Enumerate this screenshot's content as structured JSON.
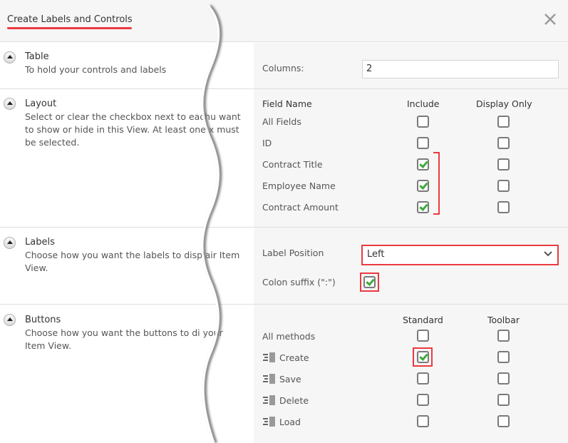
{
  "dialog": {
    "title": "Create Labels and Controls",
    "close_icon": "close-icon"
  },
  "sections": {
    "table": {
      "title": "Table",
      "description": "To hold your controls and labels",
      "columns_label": "Columns:",
      "columns_value": "2"
    },
    "layout": {
      "title": "Layout",
      "description": "Select or clear the checkbox next to eachu want to show or hide in this View. At least one x must be selected.",
      "headers": {
        "field_name": "Field Name",
        "include": "Include",
        "display_only": "Display Only"
      },
      "rows": [
        {
          "name": "All Fields",
          "include": false,
          "display_only": false
        },
        {
          "name": "ID",
          "include": false,
          "display_only": false
        },
        {
          "name": "Contract Title",
          "include": true,
          "display_only": false
        },
        {
          "name": "Employee Name",
          "include": true,
          "display_only": false
        },
        {
          "name": "Contract Amount",
          "include": true,
          "display_only": false
        }
      ]
    },
    "labels": {
      "title": "Labels",
      "description": "Choose how you want the labels to displair Item View.",
      "label_position_label": "Label Position",
      "label_position_value": "Left",
      "colon_suffix_label": "Colon suffix (\":\")",
      "colon_suffix_checked": true
    },
    "buttons": {
      "title": "Buttons",
      "description": "Choose how you want the buttons to di your Item View.",
      "headers": {
        "standard": "Standard",
        "toolbar": "Toolbar"
      },
      "rows": [
        {
          "name": "All methods",
          "icon": null,
          "standard": false,
          "toolbar": false
        },
        {
          "name": "Create",
          "icon": "method-icon",
          "standard": true,
          "toolbar": false
        },
        {
          "name": "Save",
          "icon": "method-icon",
          "standard": false,
          "toolbar": false
        },
        {
          "name": "Delete",
          "icon": "method-icon",
          "standard": false,
          "toolbar": false
        },
        {
          "name": "Load",
          "icon": "method-icon",
          "standard": false,
          "toolbar": false
        }
      ]
    }
  },
  "colors": {
    "highlight": "#ec3a41",
    "check": "#3eaa3e",
    "panel_bg": "#f6f6f6"
  }
}
